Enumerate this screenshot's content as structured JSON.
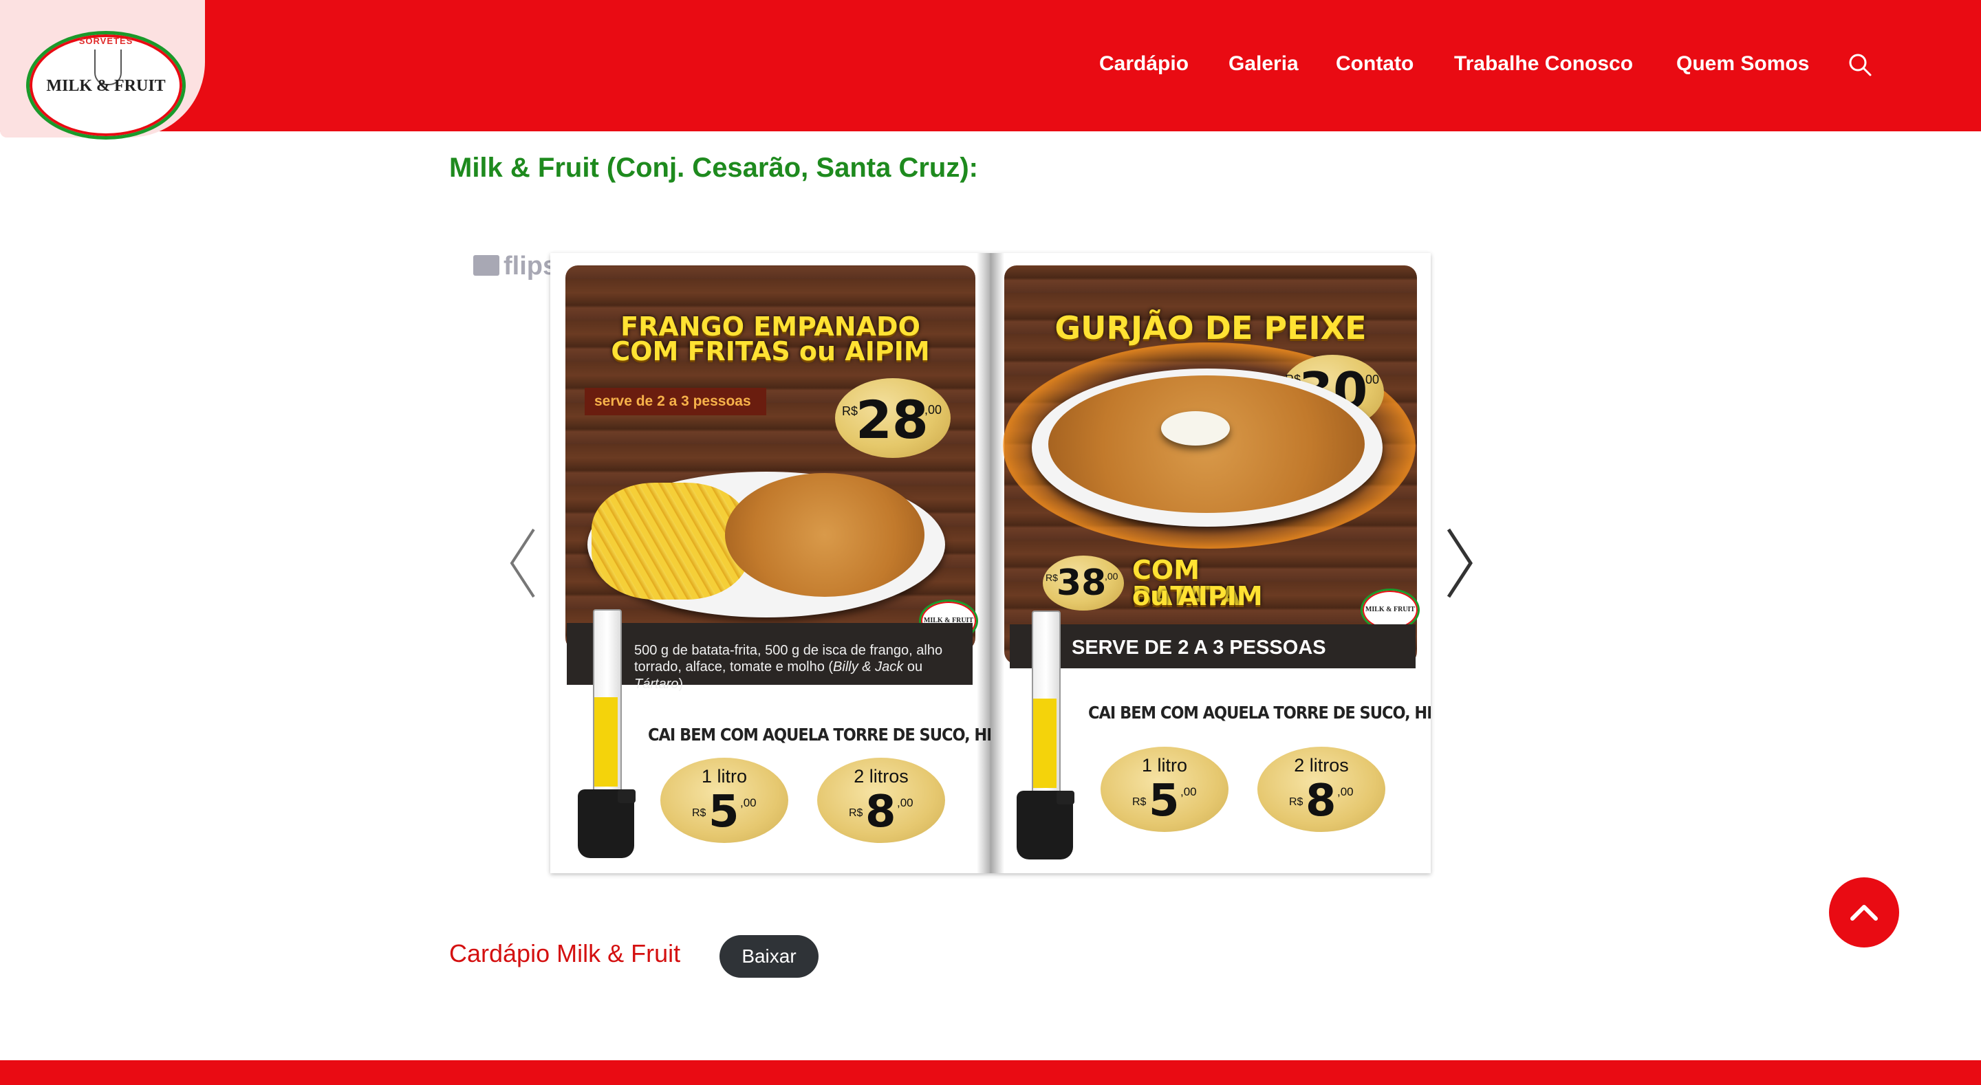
{
  "header": {
    "logo": {
      "top_text": "SORVETES",
      "name": "MILK & FRUIT"
    },
    "nav": [
      {
        "label": "Cardápio"
      },
      {
        "label": "Galeria"
      },
      {
        "label": "Contato"
      },
      {
        "label": "Trabalhe Conosco"
      },
      {
        "label": "Quem Somos"
      }
    ],
    "search_icon": "search-icon"
  },
  "main": {
    "title": "Milk & Fruit (Conj. Cesarão, Santa Cruz):",
    "flipbook": {
      "brand": "flipsnack",
      "left_page": {
        "headline_line1": "FRANGO EMPANADO",
        "headline_line2": "COM FRITAS ou AIPIM",
        "serve_tag": "serve de 2 a 3 pessoas",
        "price": {
          "currency": "R$",
          "value": "28",
          "cents": ",00"
        },
        "description_plain_1": "500 g de batata-frita, 500 g de isca de frango, alho torrado, alface, tomate e molho (",
        "description_italic_1": "Billy & Jack",
        "description_plain_2": " ou ",
        "description_italic_2": "Tártaro",
        "description_plain_3": ")",
        "juice_title": "CAI BEM COM AQUELA TORRE DE SUCO, HEIN!",
        "juice_options": [
          {
            "label": "1 litro",
            "currency": "R$",
            "value": "5",
            "cents": ",00"
          },
          {
            "label": "2 litros",
            "currency": "R$",
            "value": "8",
            "cents": ",00"
          }
        ],
        "mini_logo": "MILK & FRUIT"
      },
      "right_page": {
        "headline": "GURJÃO DE PEIXE",
        "price": {
          "currency": "R$",
          "value": "30",
          "cents": ",00"
        },
        "combo_price": {
          "currency": "R$",
          "value": "38",
          "cents": ",00"
        },
        "combo_line1": "COM BATATA",
        "combo_line2": "ou AIPIM",
        "serve_text": "SERVE DE 2 A 3 PESSOAS",
        "juice_title": "CAI BEM COM AQUELA TORRE DE SUCO, HEIN!",
        "juice_options": [
          {
            "label": "1 litro",
            "currency": "R$",
            "value": "5",
            "cents": ",00"
          },
          {
            "label": "2 litros",
            "currency": "R$",
            "value": "8",
            "cents": ",00"
          }
        ],
        "mini_logo": "MILK & FRUIT"
      }
    },
    "download_row": {
      "label": "Cardápio Milk & Fruit",
      "button": "Baixar"
    }
  },
  "colors": {
    "brand_red": "#e90b13",
    "title_green": "#1e8a1e",
    "button_dark": "#2f3337"
  },
  "icons": {
    "prev": "chevron-left-icon",
    "next": "chevron-right-icon",
    "back_to_top": "chevron-up-icon"
  }
}
